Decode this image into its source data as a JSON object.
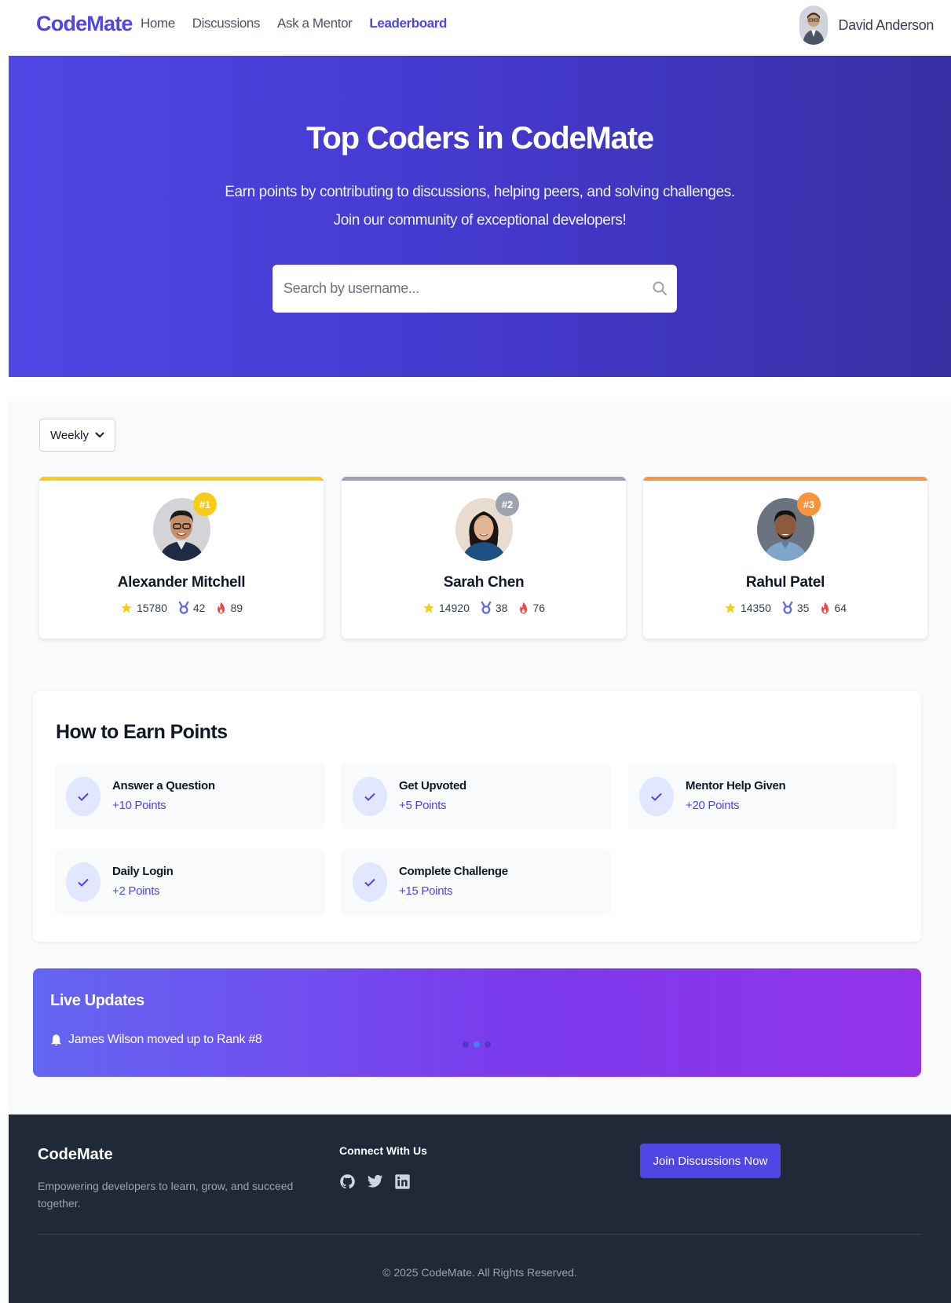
{
  "nav": {
    "brand": "CodeMate",
    "links": [
      {
        "label": "Home",
        "active": false
      },
      {
        "label": "Discussions",
        "active": false
      },
      {
        "label": "Ask a Mentor",
        "active": false
      },
      {
        "label": "Leaderboard",
        "active": true
      }
    ],
    "user_name": "David Anderson"
  },
  "hero": {
    "title": "Top Coders in CodeMate",
    "subtitle_line1": "Earn points by contributing to discussions, helping peers, and solving challenges.",
    "subtitle_line2": "Join our community of exceptional developers!",
    "search_placeholder": "Search by username..."
  },
  "filter": {
    "period": "Weekly"
  },
  "top_coders": [
    {
      "rank": "#1",
      "name": "Alexander Mitchell",
      "points": "15780",
      "medals": "42",
      "streak": "89",
      "color": "#facc15"
    },
    {
      "rank": "#2",
      "name": "Sarah Chen",
      "points": "14920",
      "medals": "38",
      "streak": "76",
      "color": "#9ca3af"
    },
    {
      "rank": "#3",
      "name": "Rahul Patel",
      "points": "14350",
      "medals": "35",
      "streak": "64",
      "color": "#fb923c"
    }
  ],
  "earn": {
    "title": "How to Earn Points",
    "items": [
      {
        "name": "Answer a Question",
        "points": "+10 Points"
      },
      {
        "name": "Get Upvoted",
        "points": "+5 Points"
      },
      {
        "name": "Mentor Help Given",
        "points": "+20 Points"
      },
      {
        "name": "Daily Login",
        "points": "+2 Points"
      },
      {
        "name": "Complete Challenge",
        "points": "+15 Points"
      }
    ]
  },
  "live": {
    "title": "Live Updates",
    "message": "James Wilson moved up to Rank #8",
    "active_dot": 1
  },
  "footer": {
    "brand": "CodeMate",
    "description": "Empowering developers to learn, grow, and succeed together.",
    "connect_title": "Connect With Us",
    "social": [
      "github-icon",
      "twitter-icon",
      "linkedin-icon"
    ],
    "cta": "Join Discussions Now",
    "copyright": "© 2025 CodeMate. All Rights Reserved."
  },
  "colors": {
    "primary": "#4f46e5",
    "gold": "#facc15",
    "silver": "#9ca3af",
    "bronze": "#fb923c",
    "footer_bg": "#1f2937"
  }
}
